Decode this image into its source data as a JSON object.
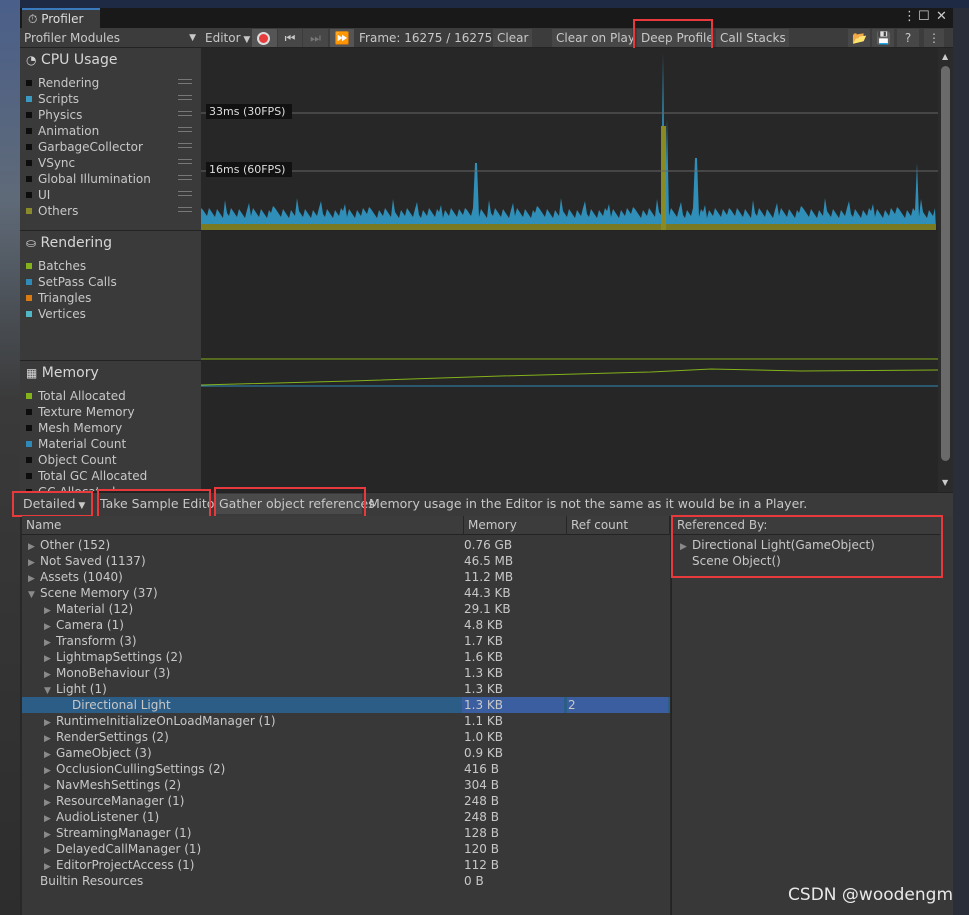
{
  "window": {
    "tab_title": "Profiler",
    "menu_icon": "kebab-icon",
    "max_icon": "maximize-icon",
    "close_icon": "close-icon"
  },
  "toolbar": {
    "modules_dropdown": "Profiler Modules",
    "target": "Editor",
    "frame": "Frame: 16275 / 16275",
    "clear": "Clear",
    "clear_on_play": "Clear on Play",
    "deep_profile": "Deep Profile",
    "call_stacks": "Call Stacks",
    "record_color": "#e83b3b"
  },
  "modules": [
    {
      "title": "CPU Usage",
      "icon": "cpu-icon",
      "items": [
        {
          "label": "Rendering",
          "color": "#0d0d0d"
        },
        {
          "label": "Scripts",
          "color": "#3a9ac1"
        },
        {
          "label": "Physics",
          "color": "#0d0d0d"
        },
        {
          "label": "Animation",
          "color": "#0d0d0d"
        },
        {
          "label": "GarbageCollector",
          "color": "#0d0d0d"
        },
        {
          "label": "VSync",
          "color": "#0d0d0d"
        },
        {
          "label": "Global Illumination",
          "color": "#0d0d0d"
        },
        {
          "label": "UI",
          "color": "#0d0d0d"
        },
        {
          "label": "Others",
          "color": "#8a8a2a"
        }
      ],
      "markers": [
        "33ms (30FPS)",
        "16ms (60FPS)"
      ]
    },
    {
      "title": "Rendering",
      "icon": "rendering-icon",
      "items": [
        {
          "label": "Batches",
          "color": "#84b21a"
        },
        {
          "label": "SetPass Calls",
          "color": "#2f8ab8"
        },
        {
          "label": "Triangles",
          "color": "#d97b10"
        },
        {
          "label": "Vertices",
          "color": "#4fb7c6"
        }
      ]
    },
    {
      "title": "Memory",
      "icon": "memory-chip-icon",
      "items": [
        {
          "label": "Total Allocated",
          "color": "#84b21a"
        },
        {
          "label": "Texture Memory",
          "color": "#0d0d0d"
        },
        {
          "label": "Mesh Memory",
          "color": "#0d0d0d"
        },
        {
          "label": "Material Count",
          "color": "#2f8ab8"
        },
        {
          "label": "Object Count",
          "color": "#0d0d0d"
        },
        {
          "label": "Total GC Allocated",
          "color": "#0d0d0d"
        },
        {
          "label": "GC Allocated",
          "color": "#0d0d0d"
        }
      ]
    }
  ],
  "memory_toolbar": {
    "mode": "Detailed",
    "take_sample": "Take Sample Editor",
    "gather_refs": "Gather object references",
    "notice": "Memory usage in the Editor is not the same as it would be in a Player."
  },
  "table": {
    "columns": [
      "Name",
      "Memory",
      "Ref count"
    ],
    "rows": [
      {
        "name": "Other (152)",
        "memory": "0.76 GB",
        "ref": "",
        "level": 0,
        "expand": "collapsed"
      },
      {
        "name": "Not Saved (1137)",
        "memory": "46.5 MB",
        "ref": "",
        "level": 0,
        "expand": "collapsed"
      },
      {
        "name": "Assets (1040)",
        "memory": "11.2 MB",
        "ref": "",
        "level": 0,
        "expand": "collapsed"
      },
      {
        "name": "Scene Memory (37)",
        "memory": "44.3 KB",
        "ref": "",
        "level": 0,
        "expand": "expanded"
      },
      {
        "name": "Material (12)",
        "memory": "29.1 KB",
        "ref": "",
        "level": 1,
        "expand": "collapsed"
      },
      {
        "name": "Camera (1)",
        "memory": "4.8 KB",
        "ref": "",
        "level": 1,
        "expand": "collapsed"
      },
      {
        "name": "Transform (3)",
        "memory": "1.7 KB",
        "ref": "",
        "level": 1,
        "expand": "collapsed"
      },
      {
        "name": "LightmapSettings (2)",
        "memory": "1.6 KB",
        "ref": "",
        "level": 1,
        "expand": "collapsed"
      },
      {
        "name": "MonoBehaviour (3)",
        "memory": "1.3 KB",
        "ref": "",
        "level": 1,
        "expand": "collapsed"
      },
      {
        "name": "Light (1)",
        "memory": "1.3 KB",
        "ref": "",
        "level": 1,
        "expand": "expanded"
      },
      {
        "name": "Directional Light",
        "memory": "1.3 KB",
        "ref": "2",
        "level": 2,
        "expand": "none",
        "selected": true
      },
      {
        "name": "RuntimeInitializeOnLoadManager (1)",
        "memory": "1.1 KB",
        "ref": "",
        "level": 1,
        "expand": "collapsed"
      },
      {
        "name": "RenderSettings (2)",
        "memory": "1.0 KB",
        "ref": "",
        "level": 1,
        "expand": "collapsed"
      },
      {
        "name": "GameObject (3)",
        "memory": "0.9 KB",
        "ref": "",
        "level": 1,
        "expand": "collapsed"
      },
      {
        "name": "OcclusionCullingSettings (2)",
        "memory": "416 B",
        "ref": "",
        "level": 1,
        "expand": "collapsed"
      },
      {
        "name": "NavMeshSettings (2)",
        "memory": "304 B",
        "ref": "",
        "level": 1,
        "expand": "collapsed"
      },
      {
        "name": "ResourceManager (1)",
        "memory": "248 B",
        "ref": "",
        "level": 1,
        "expand": "collapsed"
      },
      {
        "name": "AudioListener (1)",
        "memory": "248 B",
        "ref": "",
        "level": 1,
        "expand": "collapsed"
      },
      {
        "name": "StreamingManager (1)",
        "memory": "128 B",
        "ref": "",
        "level": 1,
        "expand": "collapsed"
      },
      {
        "name": "DelayedCallManager (1)",
        "memory": "120 B",
        "ref": "",
        "level": 1,
        "expand": "collapsed"
      },
      {
        "name": "EditorProjectAccess (1)",
        "memory": "112 B",
        "ref": "",
        "level": 1,
        "expand": "collapsed"
      },
      {
        "name": "Builtin Resources",
        "memory": "0 B",
        "ref": "",
        "level": 0,
        "expand": "none"
      }
    ]
  },
  "referenced_by": {
    "title": "Referenced By:",
    "items": [
      {
        "label": "Directional Light(GameObject)",
        "expand": "collapsed"
      },
      {
        "label": "Scene Object()",
        "expand": "none"
      }
    ]
  },
  "watermark": "CSDN @woodengm"
}
